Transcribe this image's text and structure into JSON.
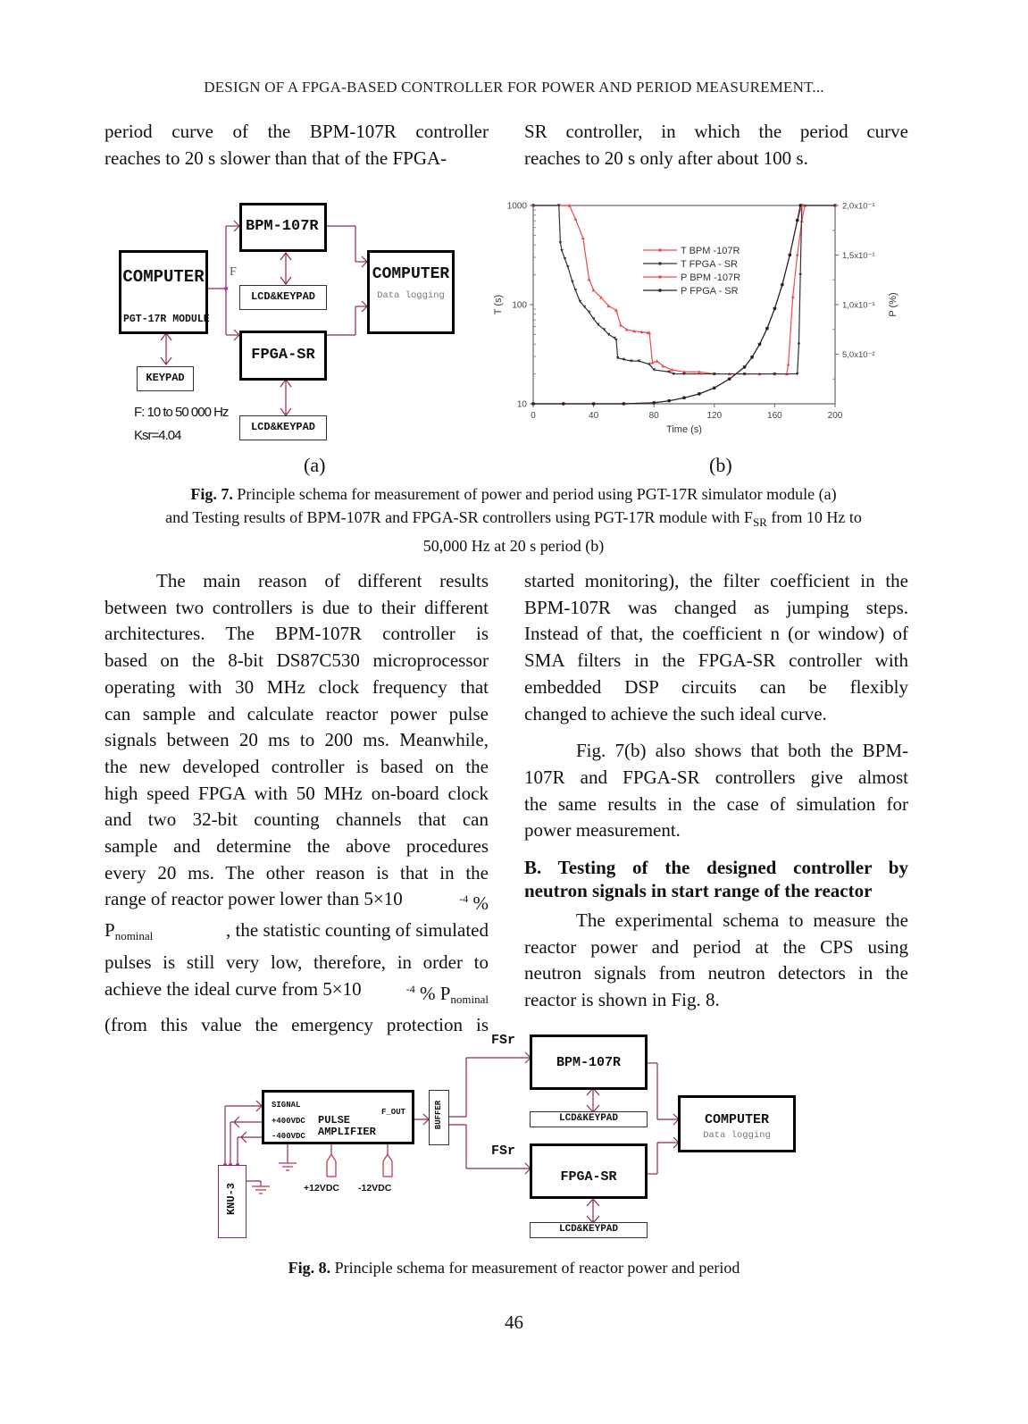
{
  "running_header": "DESIGN OF A FPGA-BASED CONTROLLER FOR POWER AND PERIOD MEASUREMENT...",
  "top_text": {
    "left_lines": [
      "period curve of the BPM-107R controller",
      "reaches to 20 s slower than that of the FPGA-"
    ],
    "right_lines": [
      "SR controller, in which the period curve",
      "reaches to 20 s only after about 100 s."
    ]
  },
  "fig7a": {
    "computer_src_title": "COMPUTER",
    "computer_src_module": "PGT-17R MODULE",
    "keypad": "KEYPAD",
    "signal_label": "F",
    "bpm_box": "BPM-107R",
    "fpga_box": "FPGA-SR",
    "lcd_top": "LCD&KEYPAD",
    "lcd_bottom": "LCD&KEYPAD",
    "computer_dst_title": "COMPUTER",
    "computer_dst_sub": "Data logging",
    "freq_note": "F: 10 to 50 000 Hz",
    "ksr_note": "Ksr=4.04",
    "panel_label": "(a)"
  },
  "fig7b": {
    "panel_label": "(b)"
  },
  "chart_data": {
    "type": "line",
    "title": "",
    "xlabel": "Time (s)",
    "ylabel": "T (s)",
    "y2label": "P (%)",
    "xlim": [
      0,
      200
    ],
    "ylim": [
      10,
      1000
    ],
    "yscale": "log",
    "y2lim": [
      0,
      0.2
    ],
    "x_ticks": [
      "0",
      "40",
      "80",
      "120",
      "160",
      "200"
    ],
    "y_ticks": [
      "10",
      "100",
      "1000"
    ],
    "y2_ticks": [
      "5,0x10⁻²",
      "1,0x10⁻¹",
      "1,5x10⁻¹",
      "2,0x10⁻¹"
    ],
    "legend_position": "upper-center",
    "series": [
      {
        "name": "T BPM -107R",
        "axis": "left",
        "color": "#f04a4a",
        "marker": "triangle-up",
        "x": [
          0,
          24,
          28,
          33,
          37,
          40,
          45,
          50,
          55,
          58,
          62,
          67,
          72,
          76,
          77,
          79,
          82,
          86,
          92,
          100,
          110,
          120,
          130,
          140,
          150,
          160,
          168,
          169,
          172,
          175,
          178,
          180,
          200
        ],
        "y": [
          1000,
          1000,
          730,
          470,
          180,
          140,
          118,
          97,
          88,
          62,
          56,
          54,
          53,
          52,
          52,
          26,
          27,
          24,
          22,
          21,
          21,
          20,
          20,
          20,
          20,
          20,
          20,
          25,
          120,
          320,
          700,
          1000,
          1000
        ]
      },
      {
        "name": "T FPGA - SR",
        "axis": "left",
        "color": "#333333",
        "marker": "tri-down",
        "x": [
          0,
          17,
          18,
          19,
          21,
          23,
          26,
          28,
          31,
          34,
          37,
          40,
          43,
          47,
          50,
          54,
          55,
          56,
          60,
          65,
          70,
          77,
          80,
          90,
          93,
          100,
          120,
          140,
          160,
          175,
          176,
          177,
          178,
          200
        ],
        "y": [
          1000,
          1000,
          420,
          350,
          290,
          240,
          170,
          140,
          108,
          95,
          84,
          72,
          63,
          56,
          50,
          46,
          44,
          29,
          28,
          27,
          27,
          25,
          22,
          21,
          20,
          20,
          20,
          20,
          20,
          20,
          40,
          200,
          1000,
          1000
        ]
      },
      {
        "name": "P BPM -107R",
        "axis": "right",
        "color": "#f04a4a",
        "marker": "triangle-down",
        "x": [
          0,
          20,
          40,
          60,
          80,
          90,
          100,
          110,
          120,
          130,
          140,
          145,
          150,
          155,
          160,
          165,
          170,
          175,
          178
        ],
        "y": [
          0.0,
          0.0,
          0.0,
          0.0,
          0.001,
          0.003,
          0.006,
          0.01,
          0.016,
          0.025,
          0.037,
          0.047,
          0.06,
          0.076,
          0.096,
          0.12,
          0.15,
          0.185,
          0.2
        ]
      },
      {
        "name": "P FPGA - SR",
        "axis": "right",
        "color": "#222222",
        "marker": "circle",
        "x": [
          0,
          20,
          40,
          60,
          80,
          90,
          100,
          110,
          120,
          130,
          140,
          145,
          150,
          155,
          160,
          165,
          170,
          175,
          177
        ],
        "y": [
          0.0,
          0.0,
          0.0,
          0.0,
          0.001,
          0.003,
          0.006,
          0.01,
          0.016,
          0.025,
          0.037,
          0.047,
          0.06,
          0.076,
          0.096,
          0.12,
          0.15,
          0.185,
          0.2
        ]
      }
    ]
  },
  "fig7_caption": {
    "label": "Fig. 7.",
    "line1": " Principle schema for measurement of power and period using PGT-17R simulator module (a)",
    "line2_pre": "and Testing results of BPM-107R and FPGA-SR controllers using PGT-17R module with F",
    "line2_sub": "SR",
    "line2_post": " from 10 Hz to",
    "line3": "50,000 Hz at 20 s period (b)"
  },
  "left_column": {
    "lines": [
      "The main reason of different results",
      "between two controllers is due to their different",
      "architectures. The BPM-107R controller is",
      "based on the 8-bit DS87C530 microprocessor",
      "operating with 30 MHz clock frequency that",
      "can sample and calculate reactor power pulse",
      "signals between 20 ms to 200 ms. Meanwhile,",
      "the new developed controller is based on the",
      "high speed FPGA with 50 MHz on-board clock",
      "and two 32-bit counting channels that can",
      "sample and determine the above procedures",
      "every 20 ms. The other reason is that in the"
    ],
    "line13_pre": "range of reactor power lower than 5×10",
    "line13_sup": "-4",
    "line13_post": " %",
    "line14_p": "P",
    "line14_sub": "nominal",
    "line14_post": ", the statistic counting of simulated",
    "line15": "pulses is still very low, therefore, in order to",
    "line16_pre": "achieve the ideal curve from 5×10",
    "line16_sup": "-4",
    "line16_mid": " % P",
    "line16_sub": "nominal",
    "line17": "(from this value the emergency protection is"
  },
  "right_column": {
    "para1_lines": [
      "started monitoring), the filter coefficient in the",
      "BPM-107R was changed as jumping steps.",
      "Instead of that, the coefficient n (or window) of",
      "SMA filters in the FPGA-SR controller with",
      "embedded DSP circuits can be flexibly",
      "changed to achieve the such ideal curve."
    ],
    "para2_lines": [
      "Fig. 7(b) also shows that both the BPM-",
      "107R and FPGA-SR controllers give almost",
      "the same results in the case of simulation for",
      "power measurement."
    ],
    "section_heading_lines": [
      "B. Testing of the designed controller by",
      "neutron signals in start range of the reactor"
    ],
    "para3_lines": [
      "The experimental schema to measure the",
      "reactor power and period at the CPS using",
      "neutron signals from neutron detectors in the",
      "reactor is shown in Fig. 8."
    ]
  },
  "fig8": {
    "knu": "KNU-3",
    "signal": "SIGNAL",
    "plus400": "+400VDC",
    "minus400": "-400VDC",
    "amp_line1": "PULSE",
    "amp_line2": "AMPLIFIER",
    "f_out": "F_OUT",
    "buffer": "BUFFER",
    "plus12": "+12VDC",
    "minus12": "-12VDC",
    "fsr_top": "FSr",
    "fsr_bottom": "FSr",
    "bpm_box": "BPM-107R",
    "fpga_box": "FPGA-SR",
    "lcd_top": "LCD&KEYPAD",
    "lcd_bottom": "LCD&KEYPAD",
    "computer_title": "COMPUTER",
    "computer_sub": "Data logging"
  },
  "fig8_caption": {
    "label": "Fig. 8.",
    "text": " Principle schema for measurement of reactor power and period"
  },
  "page_number": "46"
}
